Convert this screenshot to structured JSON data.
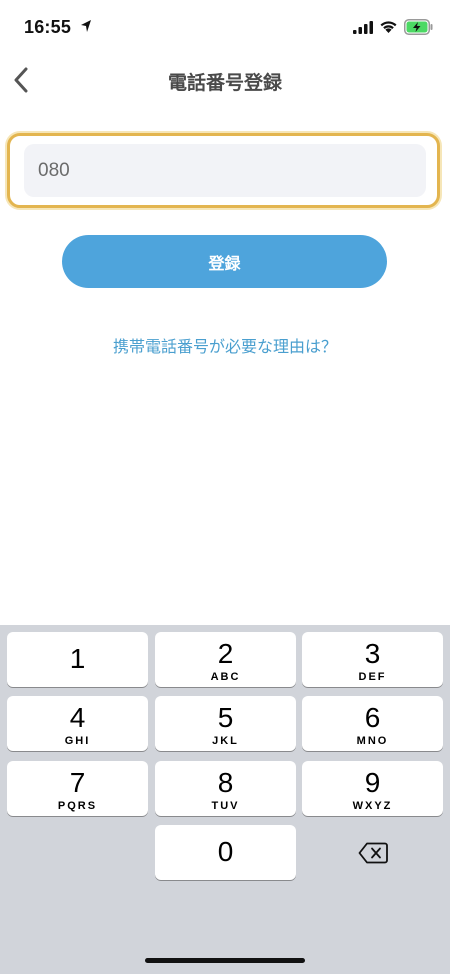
{
  "status_bar": {
    "time": "16:55",
    "icons": [
      "location-arrow-icon",
      "cellular-signal-icon",
      "wifi-icon",
      "battery-charging-icon"
    ],
    "battery_color": "#4cd964"
  },
  "nav": {
    "title": "電話番号登録",
    "back_icon": "chevron-left-icon"
  },
  "form": {
    "phone_value": "080",
    "focus_color": "#e3b54f",
    "register_label": "登録",
    "register_color": "#4ea4dc",
    "why_link": "携帯電話番号が必要な理由は？"
  },
  "keypad": {
    "keys": [
      {
        "num": "1",
        "letters": ""
      },
      {
        "num": "2",
        "letters": "ABC"
      },
      {
        "num": "3",
        "letters": "DEF"
      },
      {
        "num": "4",
        "letters": "GHI"
      },
      {
        "num": "5",
        "letters": "JKL"
      },
      {
        "num": "6",
        "letters": "MNO"
      },
      {
        "num": "7",
        "letters": "PQRS"
      },
      {
        "num": "8",
        "letters": "TUV"
      },
      {
        "num": "9",
        "letters": "WXYZ"
      },
      {
        "num": "0",
        "letters": ""
      }
    ],
    "backspace_icon": "backspace-icon"
  }
}
